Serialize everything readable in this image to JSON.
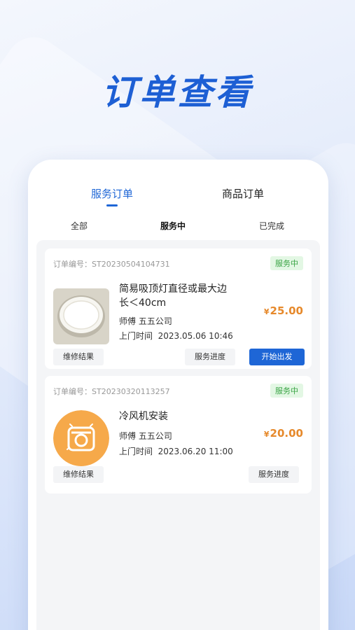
{
  "headline": "订单查看",
  "main_tabs": [
    {
      "label": "服务订单"
    },
    {
      "label": "商品订单"
    }
  ],
  "sub_tabs": [
    {
      "label": "全部"
    },
    {
      "label": "服务中"
    },
    {
      "label": "已完成"
    }
  ],
  "orders": [
    {
      "order_label": "订单编号：",
      "order_no": "ST20230504104731",
      "status": "服务中",
      "name_line1": "简易吸顶灯直径或最大边",
      "name_line2": "长＜40cm",
      "master_label": "师傅",
      "master_name": "五五公司",
      "visit_label": "上门时间",
      "visit_time": "2023.05.06 10:46",
      "price_symbol": "¥",
      "price": "25.00",
      "btn_result": "维修结果",
      "btn_progress": "服务进度",
      "btn_start": "开始出发"
    },
    {
      "order_label": "订单编号：",
      "order_no": "ST20230320113257",
      "status": "服务中",
      "name_line1": "冷风机安装",
      "master_label": "师傅",
      "master_name": "五五公司",
      "visit_label": "上门时间",
      "visit_time": "2023.06.20 11:00",
      "price_symbol": "¥",
      "price": "20.00",
      "btn_result": "维修结果",
      "btn_progress": "服务进度"
    }
  ],
  "colors": {
    "accent": "#1e66d6",
    "price": "#e6892b",
    "status_bg": "#e3f7e4",
    "status_text": "#3aa445"
  }
}
